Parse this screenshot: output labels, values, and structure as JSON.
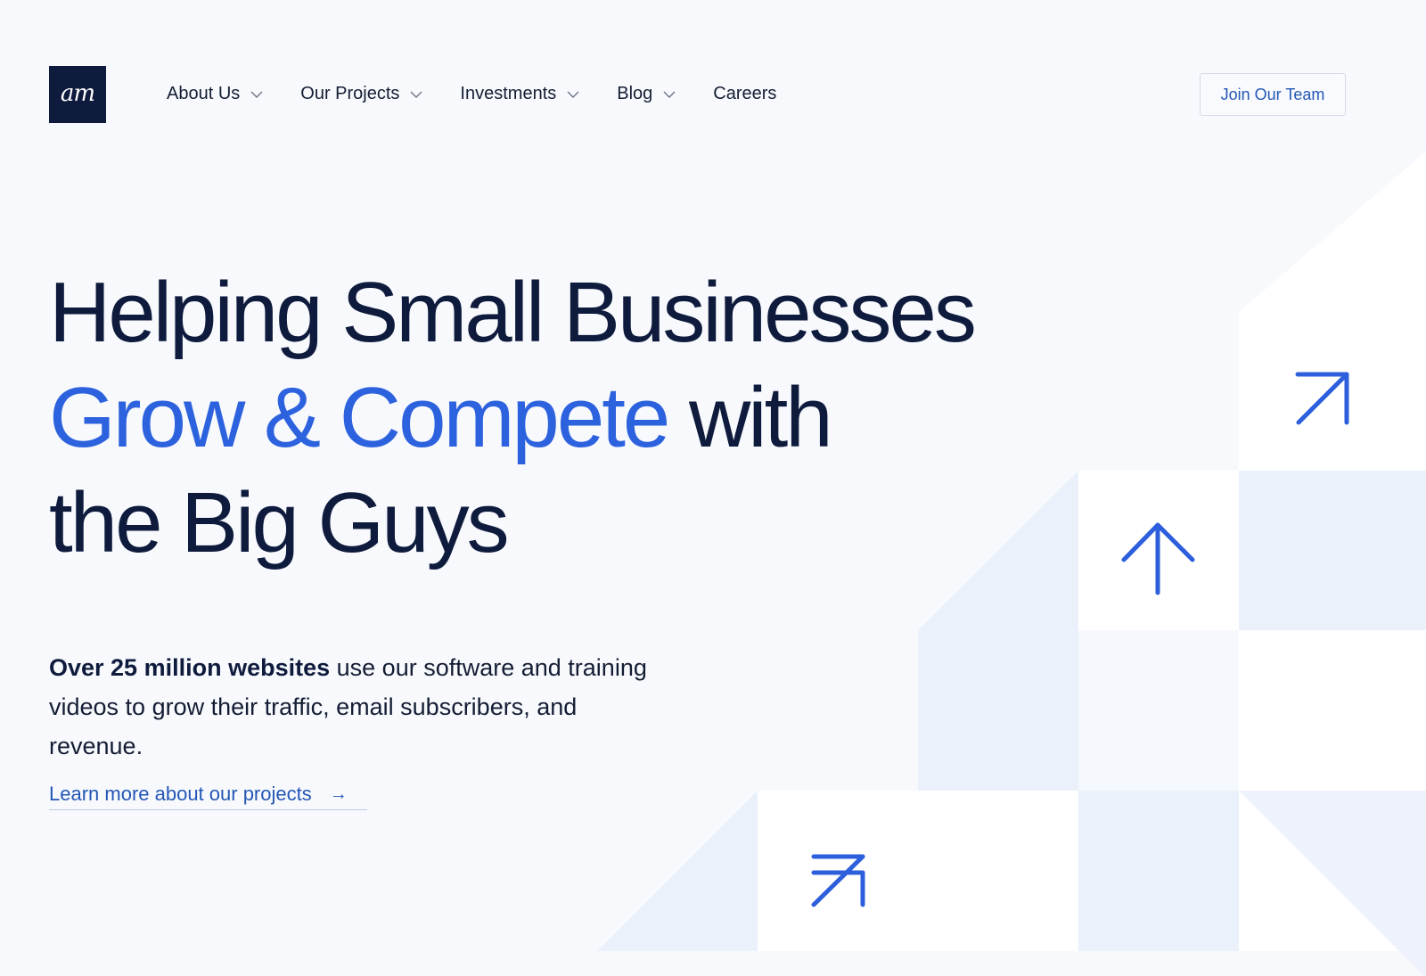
{
  "brand": {
    "logo_text": "am",
    "logo_bg": "#0f1b3d"
  },
  "nav": {
    "items": [
      {
        "label": "About Us",
        "has_dropdown": true,
        "icon": "chevron-down-icon"
      },
      {
        "label": "Our Projects",
        "has_dropdown": true,
        "icon": "chevron-down-icon"
      },
      {
        "label": "Investments",
        "has_dropdown": true,
        "icon": "chevron-down-icon"
      },
      {
        "label": "Blog",
        "has_dropdown": true,
        "icon": "chevron-down-icon"
      },
      {
        "label": "Careers",
        "has_dropdown": false
      }
    ],
    "cta_label": "Join Our Team"
  },
  "hero": {
    "headline_line1": "Helping Small Businesses",
    "headline_accent": "Grow & Compete",
    "headline_line2_rest": " with",
    "headline_line3": "the Big Guys",
    "subtext_bold": "Over 25 million websites",
    "subtext_rest": " use our software and training videos to grow their traffic, email subscribers, and revenue.",
    "link_label": "Learn more about our projects",
    "link_icon": "arrow-right-icon"
  },
  "decor": {
    "icons": [
      "arrow-up-right-icon",
      "arrow-up-icon",
      "arrow-up-right-icon"
    ]
  },
  "colors": {
    "accent": "#2d62de",
    "heading": "#0f1b3d",
    "link": "#2457b5",
    "page_bg": "#f7f9fd",
    "tile_light": "#eaf1fb",
    "tile_white": "#ffffff"
  }
}
